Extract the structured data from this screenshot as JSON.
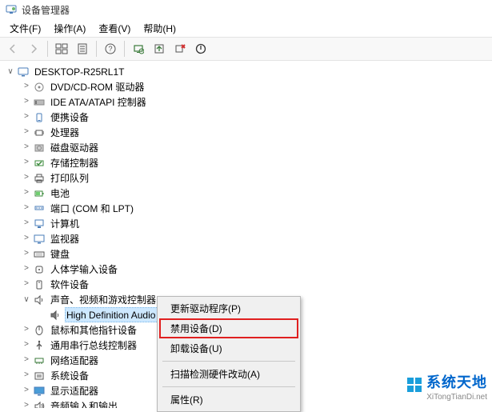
{
  "window": {
    "title": "设备管理器"
  },
  "menu": {
    "file": "文件(F)",
    "action": "操作(A)",
    "view": "查看(V)",
    "help": "帮助(H)"
  },
  "tree": {
    "root": "DESKTOP-R25RL1T",
    "items": [
      {
        "label": "DVD/CD-ROM 驱动器",
        "icon": "dvd"
      },
      {
        "label": "IDE ATA/ATAPI 控制器",
        "icon": "ide"
      },
      {
        "label": "便携设备",
        "icon": "portable"
      },
      {
        "label": "处理器",
        "icon": "cpu"
      },
      {
        "label": "磁盘驱动器",
        "icon": "disk"
      },
      {
        "label": "存储控制器",
        "icon": "storage"
      },
      {
        "label": "打印队列",
        "icon": "printer"
      },
      {
        "label": "电池",
        "icon": "battery"
      },
      {
        "label": "端口 (COM 和 LPT)",
        "icon": "port"
      },
      {
        "label": "计算机",
        "icon": "computer"
      },
      {
        "label": "监视器",
        "icon": "monitor"
      },
      {
        "label": "键盘",
        "icon": "keyboard"
      },
      {
        "label": "人体学输入设备",
        "icon": "hid"
      },
      {
        "label": "软件设备",
        "icon": "software"
      },
      {
        "label": "声音、视频和游戏控制器",
        "icon": "sound",
        "expanded": true,
        "children": [
          {
            "label": "High Definition Audio 设备",
            "icon": "speaker",
            "selected": true
          }
        ]
      },
      {
        "label": "鼠标和其他指针设备",
        "icon": "mouse"
      },
      {
        "label": "通用串行总线控制器",
        "icon": "usb"
      },
      {
        "label": "网络适配器",
        "icon": "network"
      },
      {
        "label": "系统设备",
        "icon": "system"
      },
      {
        "label": "显示适配器",
        "icon": "display"
      },
      {
        "label": "音频输入和输出",
        "icon": "audio"
      }
    ]
  },
  "context_menu": {
    "update_driver": "更新驱动程序(P)",
    "disable_device": "禁用设备(D)",
    "uninstall_device": "卸载设备(U)",
    "scan_hardware": "扫描检测硬件改动(A)",
    "properties": "属性(R)"
  },
  "watermark": {
    "main": "系统天地",
    "sub": "XiTongTianDi.net"
  },
  "colors": {
    "selection": "#cde8ff",
    "highlight_border": "#e02020",
    "link_blue": "#0066cc"
  }
}
